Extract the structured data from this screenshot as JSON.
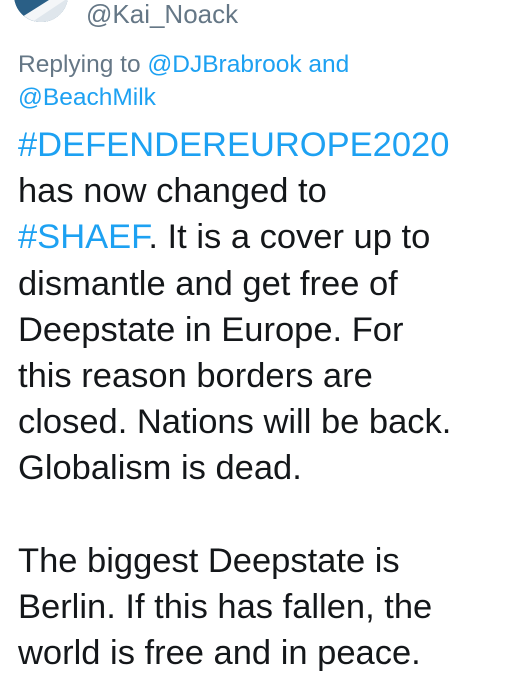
{
  "author": {
    "handle": "@Kai_Noack",
    "avatar_icon": "avatar-image"
  },
  "reply": {
    "prefix": "Replying to ",
    "mention_1": "@DJBrabrook",
    "conjunction": " and",
    "mention_2": "@BeachMilk"
  },
  "tweet": {
    "hashtag_1": "#DEFENDEREUROPE2020",
    "text_1": "has now changed to",
    "hashtag_2": "#SHAEF",
    "text_2": ". It is a cover up to",
    "text_3": "dismantle and get free of",
    "text_4": "Deepstate in Europe. For",
    "text_5": "this reason borders are",
    "text_6": "closed. Nations will be back.",
    "text_7": "Globalism is dead.",
    "text_8": "The biggest Deepstate is",
    "text_9": "Berlin. If this has fallen, the",
    "text_10": "world is free and in peace."
  },
  "colors": {
    "link": "#1da1f2",
    "secondary_text": "#657786",
    "primary_text": "#14171a"
  }
}
